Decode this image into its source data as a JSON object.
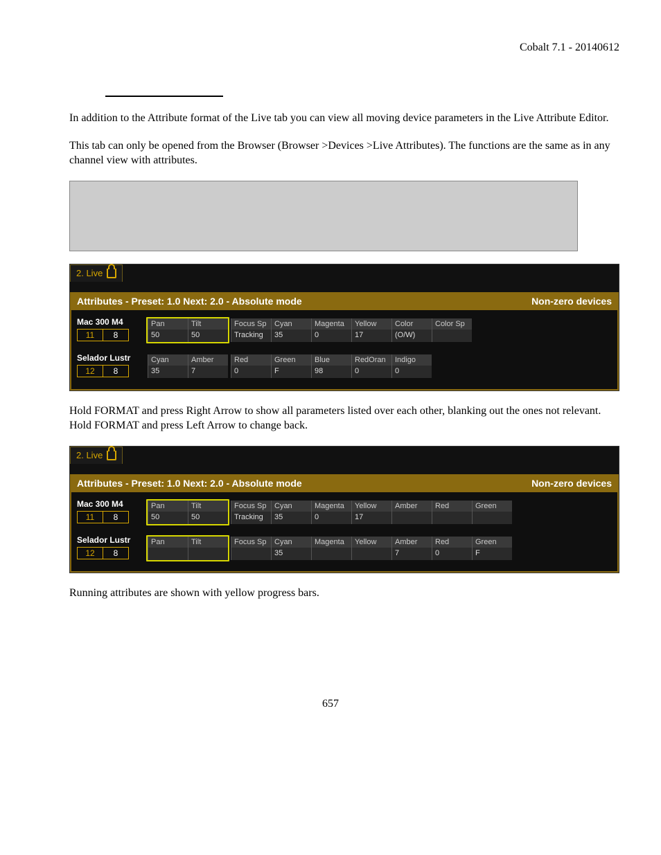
{
  "header_right": "Cobalt 7.1 - 20140612",
  "para1": "In addition to the Attribute format of the Live tab you can view all moving device parameters in the Live Attribute Editor.",
  "para2": "This tab can only be opened from the Browser (Browser >Devices >Live Attributes). The functions are the same as in any channel view with attributes.",
  "para3": "Hold FORMAT and press Right Arrow to show all parameters listed over each other, blanking out the ones not relevant. Hold FORMAT and press Left Arrow to change back.",
  "para4": "Running attributes are shown with yellow progress bars.",
  "page_number": "657",
  "ui1": {
    "tab_label": "2. Live",
    "hdr_left": "Attributes - Preset: 1.0 Next: 2.0 - Absolute mode",
    "hdr_right": "Non-zero devices",
    "rows": [
      {
        "name": "Mac 300 M4",
        "chan1": "11",
        "chan2": "8",
        "boxed": true,
        "attrs": [
          {
            "h": "Pan",
            "v": "50"
          },
          {
            "h": "Tilt",
            "v": "50"
          }
        ],
        "rest": [
          {
            "h": "Focus Sp",
            "v": "Tracking"
          },
          {
            "h": "Cyan",
            "v": "35"
          },
          {
            "h": "Magenta",
            "v": "0"
          },
          {
            "h": "Yellow",
            "v": "17"
          },
          {
            "h": "Color",
            "v": "(O/W)"
          },
          {
            "h": "Color Sp",
            "v": ""
          }
        ]
      },
      {
        "name": "Selador Lustr",
        "chan1": "12",
        "chan2": "8",
        "boxed": false,
        "attrs": [
          {
            "h": "Cyan",
            "v": "35"
          },
          {
            "h": "Amber",
            "v": "7"
          }
        ],
        "rest": [
          {
            "h": "Red",
            "v": "0"
          },
          {
            "h": "Green",
            "v": "F"
          },
          {
            "h": "Blue",
            "v": "98"
          },
          {
            "h": "RedOran",
            "v": "0"
          },
          {
            "h": "Indigo",
            "v": "0"
          }
        ]
      }
    ]
  },
  "ui2": {
    "tab_label": "2. Live",
    "hdr_left": "Attributes - Preset: 1.0 Next: 2.0 - Absolute mode",
    "hdr_right": "Non-zero devices",
    "rows": [
      {
        "name": "Mac 300 M4",
        "chan1": "11",
        "chan2": "8",
        "boxed": true,
        "attrs": [
          {
            "h": "Pan",
            "v": "50"
          },
          {
            "h": "Tilt",
            "v": "50"
          }
        ],
        "rest": [
          {
            "h": "Focus Sp",
            "v": "Tracking"
          },
          {
            "h": "Cyan",
            "v": "35"
          },
          {
            "h": "Magenta",
            "v": "0"
          },
          {
            "h": "Yellow",
            "v": "17"
          },
          {
            "h": "Amber",
            "v": ""
          },
          {
            "h": "Red",
            "v": ""
          },
          {
            "h": "Green",
            "v": ""
          }
        ]
      },
      {
        "name": "Selador Lustr",
        "chan1": "12",
        "chan2": "8",
        "boxed": true,
        "attrs": [
          {
            "h": "Pan",
            "v": ""
          },
          {
            "h": "Tilt",
            "v": ""
          }
        ],
        "rest": [
          {
            "h": "Focus Sp",
            "v": ""
          },
          {
            "h": "Cyan",
            "v": "35"
          },
          {
            "h": "Magenta",
            "v": ""
          },
          {
            "h": "Yellow",
            "v": ""
          },
          {
            "h": "Amber",
            "v": "7"
          },
          {
            "h": "Red",
            "v": "0"
          },
          {
            "h": "Green",
            "v": "F"
          }
        ]
      }
    ]
  }
}
